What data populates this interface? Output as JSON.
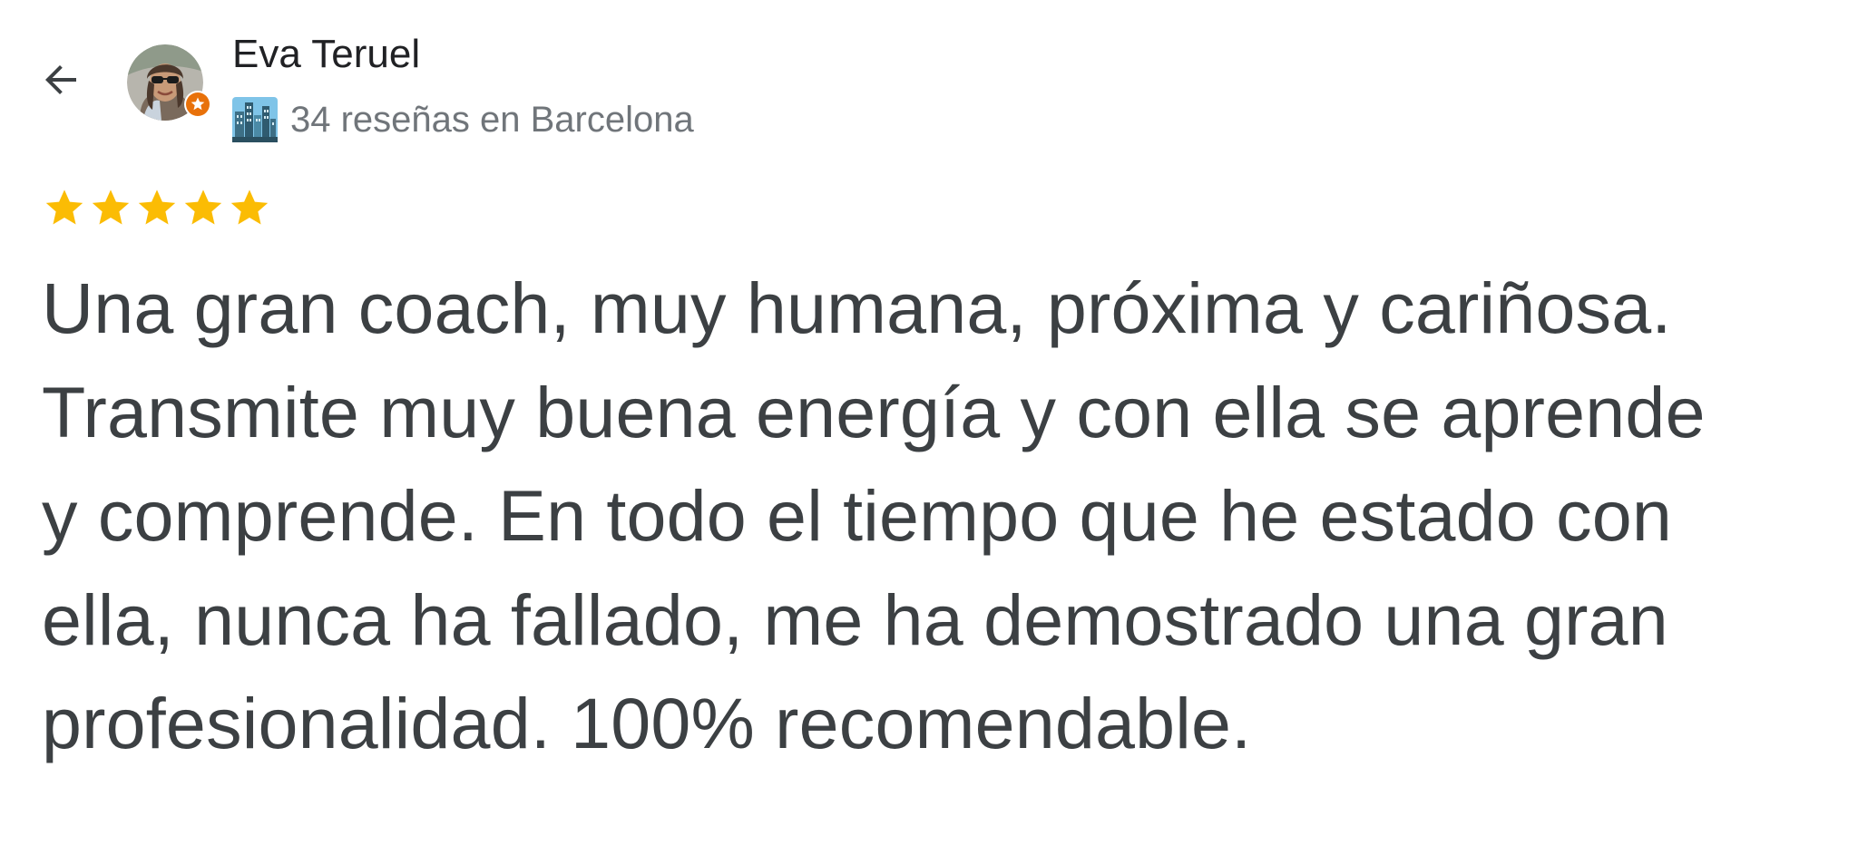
{
  "header": {
    "back_icon": "arrow-left-icon",
    "avatar_icon": "user-avatar",
    "badge_icon": "local-guide-star-badge",
    "reviewer_name": "Eva Teruel",
    "city_icon": "cityscape-icon",
    "reviews_count_text": "34 reseñas en Barcelona"
  },
  "rating": {
    "stars": 5,
    "max": 5,
    "color": "#fbbc04"
  },
  "review": {
    "lines": [
      "Una gran coach, muy humana, próxima y cariñosa.",
      "Transmite muy buena energía y con ella se aprende",
      "y comprende. En todo el tiempo que he estado con",
      "ella, nunca ha fallado, me ha demostrado una gran",
      "profesionalidad. 100% recomendable."
    ]
  },
  "colors": {
    "text": "#3c4043",
    "secondary_text": "#70757a",
    "badge": "#e8710a"
  }
}
